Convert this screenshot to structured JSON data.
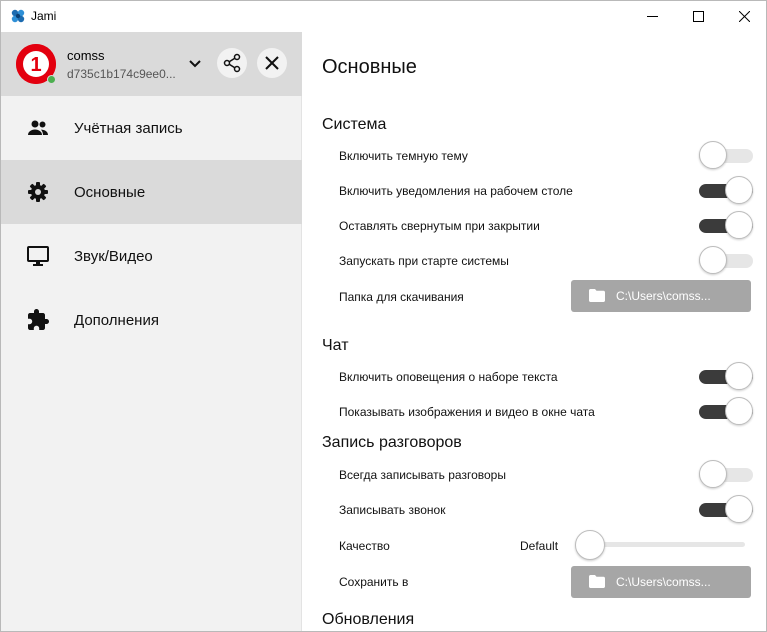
{
  "window": {
    "title": "Jami"
  },
  "account": {
    "name": "comss",
    "id": "d735c1b174c9ee0...",
    "avatar_text": "1",
    "presence_color": "#4caf50"
  },
  "sidebar": {
    "items": [
      {
        "label": "Учётная запись",
        "icon": "people-icon"
      },
      {
        "label": "Основные",
        "icon": "gear-icon"
      },
      {
        "label": "Звук/Видео",
        "icon": "monitor-icon"
      },
      {
        "label": "Дополнения",
        "icon": "puzzle-icon"
      }
    ],
    "active_index": 1
  },
  "main": {
    "title": "Основные",
    "sections": {
      "system": {
        "title": "Система",
        "dark_theme": {
          "label": "Включить темную тему",
          "on": false
        },
        "desktop_notifications": {
          "label": "Включить уведомления на рабочем столе",
          "on": true
        },
        "keep_minimized": {
          "label": "Оставлять свернутым при закрытии",
          "on": true
        },
        "run_at_startup": {
          "label": "Запускать при старте системы",
          "on": false
        },
        "download_folder": {
          "label": "Папка для скачивания",
          "path": "C:\\Users\\comss..."
        }
      },
      "chat": {
        "title": "Чат",
        "typing_indicators": {
          "label": "Включить оповещения о наборе текста",
          "on": true
        },
        "show_media": {
          "label": "Показывать изображения и видео в окне чата",
          "on": true
        }
      },
      "recording": {
        "title": "Запись разговоров",
        "always_record": {
          "label": "Всегда записывать разговоры",
          "on": false
        },
        "record_call": {
          "label": "Записывать звонок",
          "on": true
        },
        "quality": {
          "label": "Качество",
          "value": "Default",
          "level": 0
        },
        "save_to": {
          "label": "Сохранить в",
          "path": "C:\\Users\\comss..."
        }
      },
      "updates": {
        "title": "Обновления"
      }
    }
  },
  "colors": {
    "accent_dark": "#3b3b3b",
    "folder_button": "#a6a6a6",
    "sidebar_bg": "#f2f2f2",
    "active_bg": "#dadada"
  }
}
